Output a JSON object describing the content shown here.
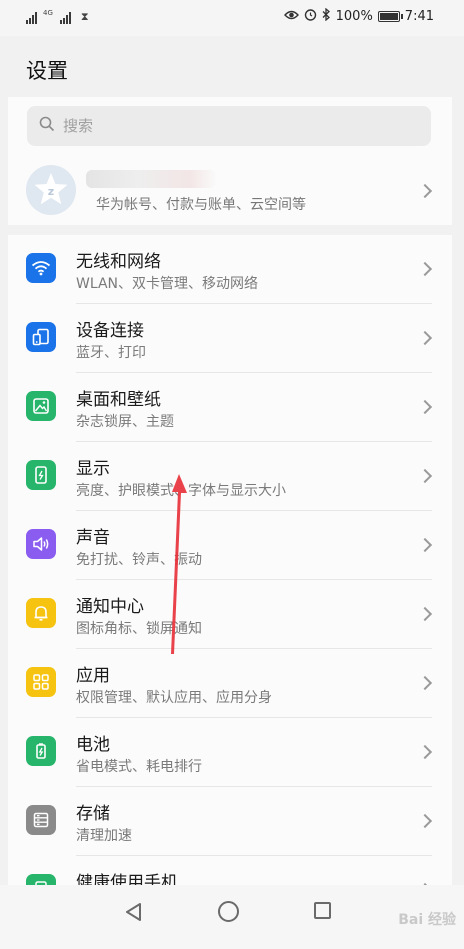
{
  "status_bar": {
    "signal_label_1": "",
    "signal_label_2": "4G",
    "icons": [
      "eye-comfort-icon",
      "alarm-icon",
      "bluetooth-icon"
    ],
    "battery_percent": "100%",
    "battery_level": 1.0,
    "time": "7:41"
  },
  "page": {
    "title": "设置"
  },
  "search": {
    "placeholder": "搜索"
  },
  "account": {
    "subtitle": "华为帐号、付款与账单、云空间等"
  },
  "settings": [
    {
      "title": "无线和网络",
      "subtitle": "WLAN、双卡管理、移动网络",
      "icon": "wifi-icon",
      "color": "#1a73e8"
    },
    {
      "title": "设备连接",
      "subtitle": "蓝牙、打印",
      "icon": "device-connection-icon",
      "color": "#1a73e8"
    },
    {
      "title": "桌面和壁纸",
      "subtitle": "杂志锁屏、主题",
      "icon": "wallpaper-icon",
      "color": "#26b56b"
    },
    {
      "title": "显示",
      "subtitle": "亮度、护眼模式、字体与显示大小",
      "icon": "display-icon",
      "color": "#26b56b"
    },
    {
      "title": "声音",
      "subtitle": "免打扰、铃声、振动",
      "icon": "sound-icon",
      "color": "#8a5cf0"
    },
    {
      "title": "通知中心",
      "subtitle": "图标角标、锁屏通知",
      "icon": "bell-icon",
      "color": "#f5c310"
    },
    {
      "title": "应用",
      "subtitle": "权限管理、默认应用、应用分身",
      "icon": "apps-icon",
      "color": "#f5c310"
    },
    {
      "title": "电池",
      "subtitle": "省电模式、耗电排行",
      "icon": "battery-icon",
      "color": "#26b56b"
    },
    {
      "title": "存储",
      "subtitle": "清理加速",
      "icon": "storage-icon",
      "color": "#8a8a8a"
    },
    {
      "title": "健康使用手机",
      "subtitle": "",
      "icon": "health-icon",
      "color": "#26b56b"
    }
  ],
  "nav_bar": {
    "icons": [
      "back-icon",
      "home-icon",
      "recents-icon"
    ]
  },
  "watermark": "Bai 经验"
}
